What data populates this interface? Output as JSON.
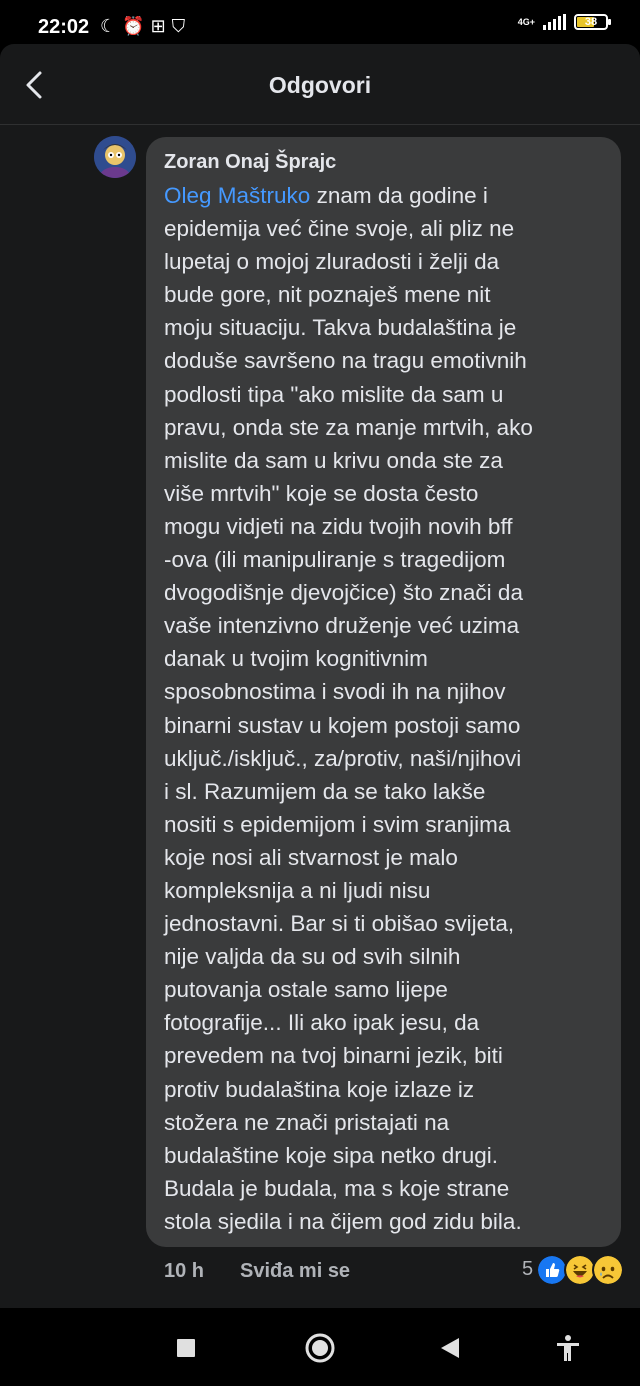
{
  "status": {
    "time": "22:02",
    "network": "4G+",
    "battery": "38"
  },
  "header": {
    "title": "Odgovori"
  },
  "comment": {
    "author": "Zoran Onaj Šprajc",
    "mention": "Oleg Maštruko",
    "text": " znam da godine i\nepidemija već čine svoje, ali pliz ne\nlupetaj o mojoj zluradosti i želji da\nbude gore, nit poznaješ mene nit\nmoju situaciju. Takva budalaština je\ndoduše savršeno na tragu emotivnih\npodlosti tipa \"ako mislite da sam u\npravu, onda ste za manje mrtvih, ako\nmislite da sam u krivu onda ste za\nviše mrtvih\" koje se dosta često\nmogu vidjeti na zidu tvojih novih bff\n-ova (ili manipuliranje s tragedijom\ndvogodišnje djevojčice) što znači da\nvaše intenzivno druženje već uzima\ndanak u tvojim kognitivnim\nsposobnostima i svodi ih na njihov\nbinarni sustav u kojem postoji samo\nuključ./isključ., za/protiv, naši/njihovi\ni sl.  Razumijem da se tako lakše\nnositi s epidemijom i svim sranjima\nkoje nosi ali stvarnost je malo\nkompleksnija a ni ljudi nisu\njednostavni. Bar si ti obišao svijeta,\nnije valjda da su od svih silnih\nputovanja  ostale samo lijepe\nfotografije... Ili ako ipak jesu, da\nprevedem na tvoj binarni jezik, biti\nprotiv budalaština koje izlaze iz\nstožera ne znači pristajati na\nbudalaštine koje sipa netko drugi.\nBudala je budala, ma s koje strane\nstola sjedila i na čijem god zidu bila.",
    "time_ago": "10 h",
    "like_label": "Sviđa mi se",
    "reaction_count": "5",
    "reactions": [
      "like-icon",
      "haha-icon",
      "sad-icon"
    ]
  },
  "colors": {
    "background": "#18191a",
    "bubble": "#3a3b3c",
    "mention": "#4599ff",
    "muted": "#b0b3b8"
  }
}
